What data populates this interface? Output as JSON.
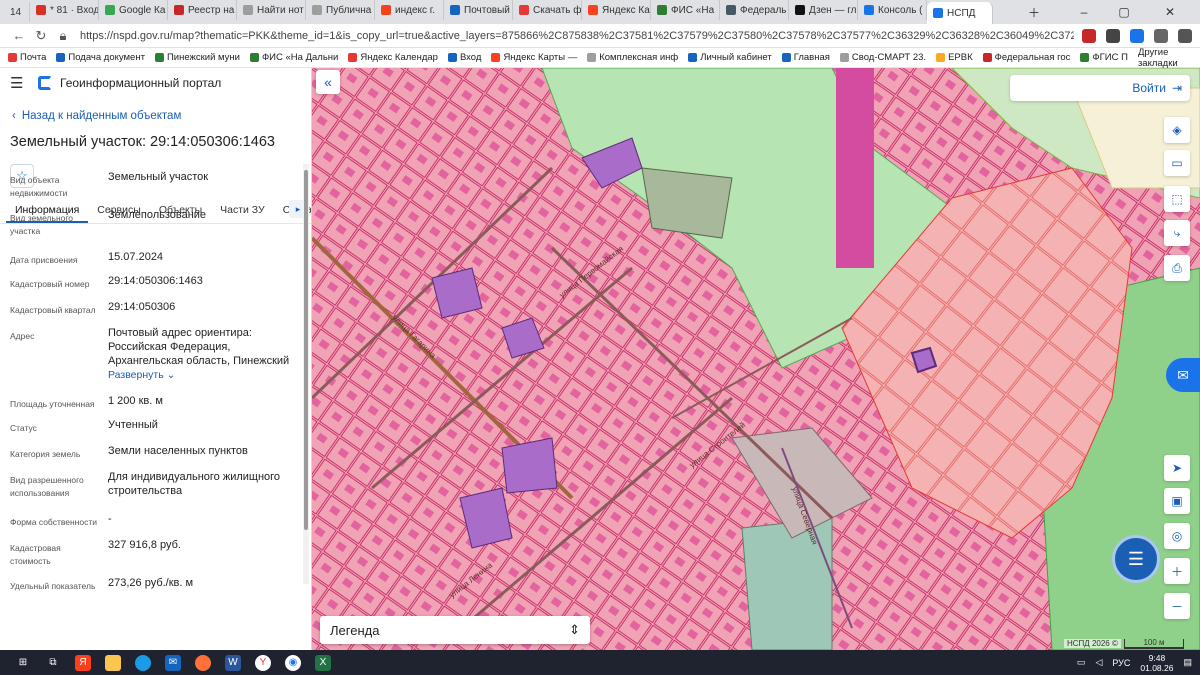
{
  "browser": {
    "tab_count": "14",
    "tabs": [
      {
        "label": "* 81 · Вход",
        "color": "#d93025"
      },
      {
        "label": "Google Ка",
        "color": "#34a853"
      },
      {
        "label": "Реестр на",
        "color": "#c62828"
      },
      {
        "label": "Найти нот",
        "color": "#9e9e9e"
      },
      {
        "label": "Публична",
        "color": "#9e9e9e"
      },
      {
        "label": "индекс г.",
        "color": "#fc3f1d"
      },
      {
        "label": "Почтовый",
        "color": "#1565c0"
      },
      {
        "label": "Скачать ф",
        "color": "#e53935"
      },
      {
        "label": "Яндекс Ка",
        "color": "#fc3f1d"
      },
      {
        "label": "ФИС «На",
        "color": "#2e7d32"
      },
      {
        "label": "Федераль",
        "color": "#455a64"
      },
      {
        "label": "Дзен — гла",
        "color": "#111111"
      },
      {
        "label": "Консоль (",
        "color": "#1a73e8"
      },
      {
        "label": "НСПД",
        "color": "#1a73e8"
      }
    ],
    "url": "https://nspd.gov.ru/map?thematic=PKK&theme_id=1&is_copy_url=true&active_layers=875866%2C875838%2C37581%2C37579%2C37580%2C37578%2C37577%2C36329%2C36328%2C36049%2C37299%2C3...",
    "bookmarks": [
      {
        "label": "Почта",
        "color": "#e53935"
      },
      {
        "label": "Подача документ",
        "color": "#1565c0"
      },
      {
        "label": "Пинежский муни",
        "color": "#2e7d32"
      },
      {
        "label": "ФИС «На Дальни",
        "color": "#2e7d32"
      },
      {
        "label": "Яндекс Календар",
        "color": "#e53935"
      },
      {
        "label": "Вход",
        "color": "#1565c0"
      },
      {
        "label": "Яндекс Карты —",
        "color": "#fc3f1d"
      },
      {
        "label": "Комплексная инф",
        "color": "#9e9e9e"
      },
      {
        "label": "Личный кабинет",
        "color": "#1565c0"
      },
      {
        "label": "Главная",
        "color": "#1565c0"
      },
      {
        "label": "Свод-СМАРТ 23.",
        "color": "#9e9e9e"
      },
      {
        "label": "ЕРВК",
        "color": "#f9a825"
      },
      {
        "label": "Федеральная гос",
        "color": "#c62828"
      },
      {
        "label": "ФГИС П",
        "color": "#2e7d32"
      }
    ],
    "other_bookmarks": "Другие закладки"
  },
  "portal": {
    "title": "Геоинформационный портал",
    "back_label": "Назад к найденным объектам",
    "object_title": "Земельный участок: 29:14:050306:1463",
    "tabs": [
      "Информация",
      "Сервисы",
      "Объекты",
      "Части ЗУ",
      "Состав"
    ],
    "active_tab": 0
  },
  "fields": [
    {
      "key": "Вид объекта недвижимости",
      "value": "Земельный участок"
    },
    {
      "key": "Вид земельного участка",
      "value": "Землепользование"
    },
    {
      "key": "Дата присвоения",
      "value": "15.07.2024"
    },
    {
      "key": "Кадастровый номер",
      "value": "29:14:050306:1463"
    },
    {
      "key": "Кадастровый квартал",
      "value": "29:14:050306"
    },
    {
      "key": "Адрес",
      "value": "Почтовый адрес ориентира: Российская Федерация, Архангельская область, Пинежский",
      "link": "Развернуть"
    },
    {
      "key": "Площадь уточненная",
      "value": "1 200 кв. м"
    },
    {
      "key": "Статус",
      "value": "Учтенный"
    },
    {
      "key": "Категория земель",
      "value": "Земли населенных пунктов"
    },
    {
      "key": "Вид разрешенного использования",
      "value": "Для индивидуального жилищного строительства"
    },
    {
      "key": "Форма собственности",
      "value": "-"
    },
    {
      "key": "Кадастровая стоимость",
      "value": "327 916,8 руб."
    },
    {
      "key": "Удельный показатель",
      "value": "273,26 руб./кв. м"
    }
  ],
  "map": {
    "login_label": "Войти",
    "legend_label": "Легенда",
    "copyright": "НСПД 2026 ©",
    "scale": "100 м",
    "street_labels": [
      "улица Гагарина",
      "улица Первомайская",
      "улица Строителей",
      "улица Ленина",
      "улица Северная"
    ]
  },
  "taskbar": {
    "lang": "РУС",
    "time": "9:48",
    "date": "01.08.26"
  }
}
